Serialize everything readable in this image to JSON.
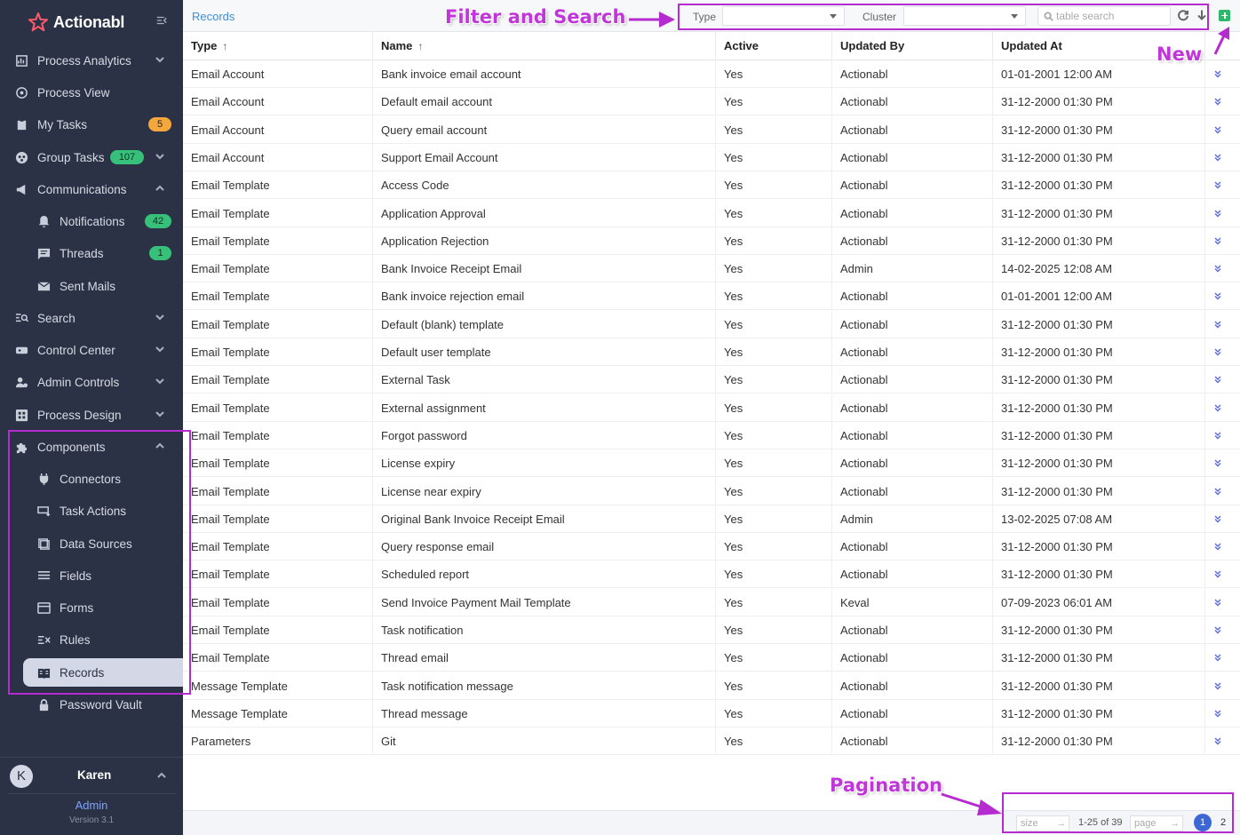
{
  "app": {
    "name": "Actionabl",
    "version": "Version 3.1"
  },
  "colors": {
    "sidebar_bg": "#2b3245",
    "accent": "#3e8ed6",
    "annotation": "#c036d8",
    "badge_orange": "#f4a73b",
    "badge_green": "#36c07a",
    "new_button": "#2fb86b"
  },
  "sidebar": {
    "items": [
      {
        "label": "Process Analytics",
        "icon": "chart-icon",
        "chevron": "down"
      },
      {
        "label": "Process View",
        "icon": "eye-icon"
      },
      {
        "label": "My Tasks",
        "icon": "clipboard-icon",
        "badge": "5"
      },
      {
        "label": "Group Tasks",
        "icon": "group-icon",
        "badge": "107",
        "chevron": "down"
      },
      {
        "label": "Communications",
        "icon": "megaphone-icon",
        "chevron": "up"
      },
      {
        "label": "Notifications",
        "icon": "bell-icon",
        "badge": "42"
      },
      {
        "label": "Threads",
        "icon": "message-icon",
        "badge": "1"
      },
      {
        "label": "Sent Mails",
        "icon": "mail-icon"
      },
      {
        "label": "Search",
        "icon": "search-list-icon",
        "chevron": "down"
      },
      {
        "label": "Control Center",
        "icon": "gamepad-icon",
        "chevron": "down"
      },
      {
        "label": "Admin Controls",
        "icon": "admin-icon",
        "chevron": "down"
      },
      {
        "label": "Process Design",
        "icon": "design-icon",
        "chevron": "down"
      },
      {
        "label": "Components",
        "icon": "puzzle-icon",
        "chevron": "up"
      },
      {
        "label": "Connectors",
        "icon": "plug-icon"
      },
      {
        "label": "Task Actions",
        "icon": "task-action-icon"
      },
      {
        "label": "Data Sources",
        "icon": "database-icon"
      },
      {
        "label": "Fields",
        "icon": "fields-icon"
      },
      {
        "label": "Forms",
        "icon": "form-icon"
      },
      {
        "label": "Rules",
        "icon": "rules-icon"
      },
      {
        "label": "Records",
        "icon": "records-icon",
        "active": true
      },
      {
        "label": "Password Vault",
        "icon": "lock-icon"
      }
    ]
  },
  "user": {
    "initial": "K",
    "name": "Karen",
    "role": "Admin"
  },
  "toolbar": {
    "breadcrumb": "Records",
    "type_label": "Type",
    "cluster_label": "Cluster",
    "type_value": "",
    "cluster_value": "",
    "search_placeholder": "table search"
  },
  "table": {
    "columns": [
      "Type",
      "Name",
      "Active",
      "Updated By",
      "Updated At"
    ],
    "sort_indicator": "↑",
    "rows": [
      [
        "Email Account",
        "Bank invoice email account",
        "Yes",
        "Actionabl",
        "01-01-2001 12:00 AM"
      ],
      [
        "Email Account",
        "Default email account",
        "Yes",
        "Actionabl",
        "31-12-2000 01:30 PM"
      ],
      [
        "Email Account",
        "Query email account",
        "Yes",
        "Actionabl",
        "31-12-2000 01:30 PM"
      ],
      [
        "Email Account",
        "Support Email Account",
        "Yes",
        "Actionabl",
        "31-12-2000 01:30 PM"
      ],
      [
        "Email Template",
        "Access Code",
        "Yes",
        "Actionabl",
        "31-12-2000 01:30 PM"
      ],
      [
        "Email Template",
        "Application Approval",
        "Yes",
        "Actionabl",
        "31-12-2000 01:30 PM"
      ],
      [
        "Email Template",
        "Application Rejection",
        "Yes",
        "Actionabl",
        "31-12-2000 01:30 PM"
      ],
      [
        "Email Template",
        "Bank Invoice Receipt Email",
        "Yes",
        "Admin",
        "14-02-2025 12:08 AM"
      ],
      [
        "Email Template",
        "Bank invoice rejection email",
        "Yes",
        "Actionabl",
        "01-01-2001 12:00 AM"
      ],
      [
        "Email Template",
        "Default (blank) template",
        "Yes",
        "Actionabl",
        "31-12-2000 01:30 PM"
      ],
      [
        "Email Template",
        "Default user template",
        "Yes",
        "Actionabl",
        "31-12-2000 01:30 PM"
      ],
      [
        "Email Template",
        "External Task",
        "Yes",
        "Actionabl",
        "31-12-2000 01:30 PM"
      ],
      [
        "Email Template",
        "External assignment",
        "Yes",
        "Actionabl",
        "31-12-2000 01:30 PM"
      ],
      [
        "Email Template",
        "Forgot password",
        "Yes",
        "Actionabl",
        "31-12-2000 01:30 PM"
      ],
      [
        "Email Template",
        "License expiry",
        "Yes",
        "Actionabl",
        "31-12-2000 01:30 PM"
      ],
      [
        "Email Template",
        "License near expiry",
        "Yes",
        "Actionabl",
        "31-12-2000 01:30 PM"
      ],
      [
        "Email Template",
        "Original Bank Invoice Receipt Email",
        "Yes",
        "Admin",
        "13-02-2025 07:08 AM"
      ],
      [
        "Email Template",
        "Query response email",
        "Yes",
        "Actionabl",
        "31-12-2000 01:30 PM"
      ],
      [
        "Email Template",
        "Scheduled report",
        "Yes",
        "Actionabl",
        "31-12-2000 01:30 PM"
      ],
      [
        "Email Template",
        "Send Invoice Payment Mail Template",
        "Yes",
        "Keval",
        "07-09-2023 06:01 AM"
      ],
      [
        "Email Template",
        "Task notification",
        "Yes",
        "Actionabl",
        "31-12-2000 01:30 PM"
      ],
      [
        "Email Template",
        "Thread email",
        "Yes",
        "Actionabl",
        "31-12-2000 01:30 PM"
      ],
      [
        "Message Template",
        "Task notification message",
        "Yes",
        "Actionabl",
        "31-12-2000 01:30 PM"
      ],
      [
        "Message Template",
        "Thread message",
        "Yes",
        "Actionabl",
        "31-12-2000 01:30 PM"
      ],
      [
        "Parameters",
        "Git",
        "Yes",
        "Actionabl",
        "31-12-2000 01:30 PM"
      ]
    ]
  },
  "pagination": {
    "size_placeholder": "size",
    "range": "1-25 of 39",
    "page_placeholder": "page",
    "pages": [
      "1",
      "2"
    ],
    "current": "1"
  },
  "annotations": {
    "filter": "Filter and Search",
    "new": "New",
    "pagination": "Pagination"
  }
}
